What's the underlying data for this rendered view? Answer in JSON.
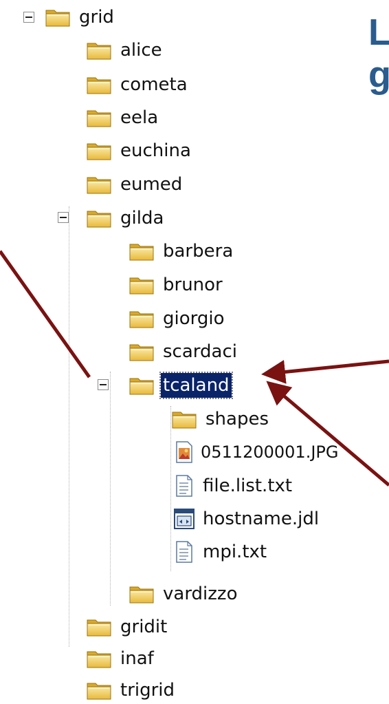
{
  "heading": {
    "line1": "L",
    "line2": "g"
  },
  "tree": {
    "root": "grid",
    "items": [
      {
        "label": "alice"
      },
      {
        "label": "cometa"
      },
      {
        "label": "eela"
      },
      {
        "label": "euchina"
      },
      {
        "label": "eumed"
      },
      {
        "label": "gilda"
      },
      {
        "label": "barbera"
      },
      {
        "label": "brunor"
      },
      {
        "label": "giorgio"
      },
      {
        "label": "scardaci"
      },
      {
        "label": "tcaland"
      },
      {
        "label": "shapes"
      },
      {
        "label": "0511200001.JPG"
      },
      {
        "label": "file.list.txt"
      },
      {
        "label": "hostname.jdl"
      },
      {
        "label": "mpi.txt"
      },
      {
        "label": "vardizzo"
      },
      {
        "label": "gridit"
      },
      {
        "label": "inaf"
      },
      {
        "label": "trigrid"
      }
    ]
  },
  "colors": {
    "selection": "#0a246a",
    "heading": "#2a5c8e",
    "arrow": "#7a1212",
    "folder": "#f2cf5b"
  }
}
